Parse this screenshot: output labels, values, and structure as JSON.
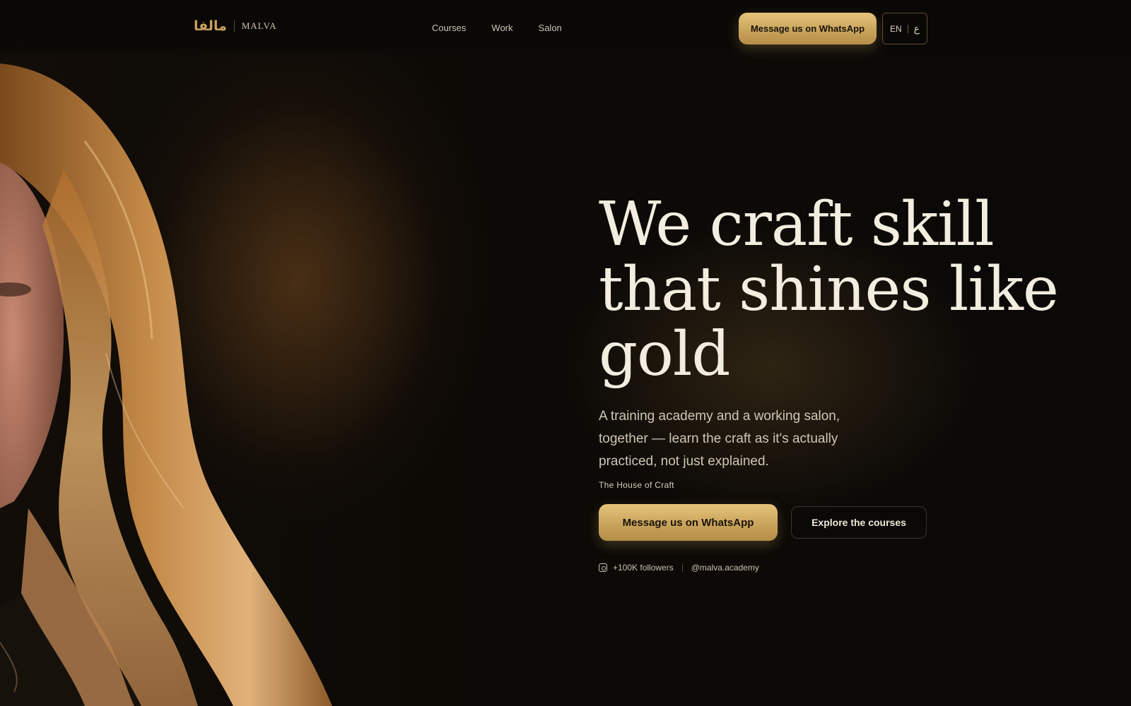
{
  "colors": {
    "accent_gold": "#c9a45c",
    "background": "#0b0907",
    "headline": "#f3ede0"
  },
  "header": {
    "logo_arabic": "مالفا",
    "logo_name": "MALVA",
    "nav": [
      "Courses",
      "Work",
      "Salon"
    ],
    "cta_label": "Message us on WhatsApp",
    "lang_en": "EN",
    "lang_ar": "ع"
  },
  "hero": {
    "headline_lines": [
      "We craft skill",
      "that shines like",
      "gold"
    ],
    "subtext": "A training academy and a working salon, together — learn the craft as it's actually practiced, not just explained.",
    "tagline": "The House of Craft",
    "primary_cta": "Message us on WhatsApp",
    "secondary_cta": "Explore the courses"
  },
  "social": {
    "icon": "instagram-icon",
    "followers": "+100K followers",
    "handle": "@malva.academy"
  }
}
